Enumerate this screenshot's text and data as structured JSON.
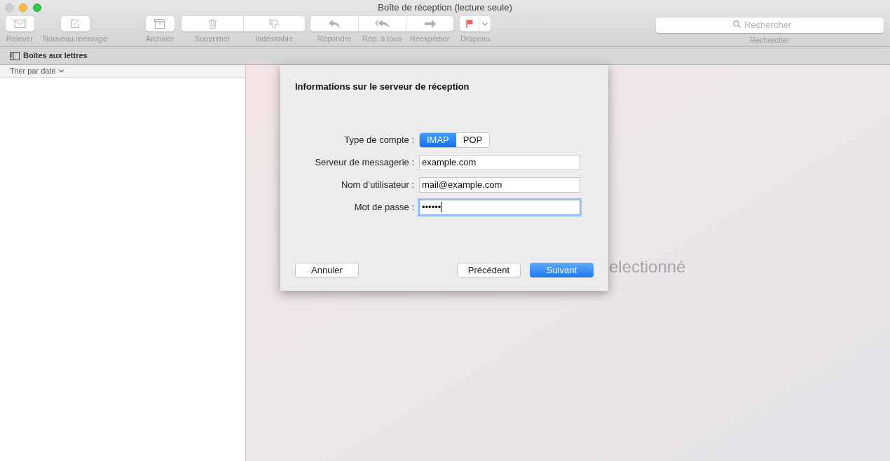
{
  "window": {
    "title": "Boîte de réception (lecture seule)"
  },
  "toolbar": {
    "groups": [
      {
        "kind": "single",
        "labels": [
          "Relever"
        ]
      },
      {
        "kind": "single",
        "labels": [
          "Nouveau message"
        ]
      },
      {
        "kind": "single",
        "labels": [
          "Archiver"
        ]
      },
      {
        "kind": "segmented",
        "labels": [
          "Supprimer",
          "Indésirable"
        ]
      },
      {
        "kind": "segmented",
        "labels": [
          "Répondre",
          "Rép. à tous",
          "Réexpédier"
        ]
      },
      {
        "kind": "flag",
        "labels": [
          "Drapeau"
        ]
      }
    ],
    "search": {
      "placeholder": "Rechercher",
      "label": "Rechercher"
    }
  },
  "mailboxes_bar": {
    "label": "Boîtes aux lettres"
  },
  "message_list": {
    "sort_label": "Trier par date"
  },
  "viewer": {
    "background_text": "electionné"
  },
  "dialog": {
    "title": "Informations sur le serveur de réception",
    "account_type": {
      "label": "Type de compte :",
      "options": [
        {
          "label": "IMAP",
          "selected": true
        },
        {
          "label": "POP",
          "selected": false
        }
      ]
    },
    "fields": [
      {
        "label": "Serveur de messagerie :",
        "value": "example.com",
        "focused": false
      },
      {
        "label": "Nom d’utilisateur :",
        "value": "mail@example.com",
        "focused": false
      },
      {
        "label": "Mot de passe :",
        "value": "••••••",
        "focused": true
      }
    ],
    "buttons": [
      {
        "label": "Annuler",
        "primary": false
      },
      {
        "label": "Précédent",
        "primary": false
      },
      {
        "label": "Suivant",
        "primary": true
      }
    ]
  }
}
